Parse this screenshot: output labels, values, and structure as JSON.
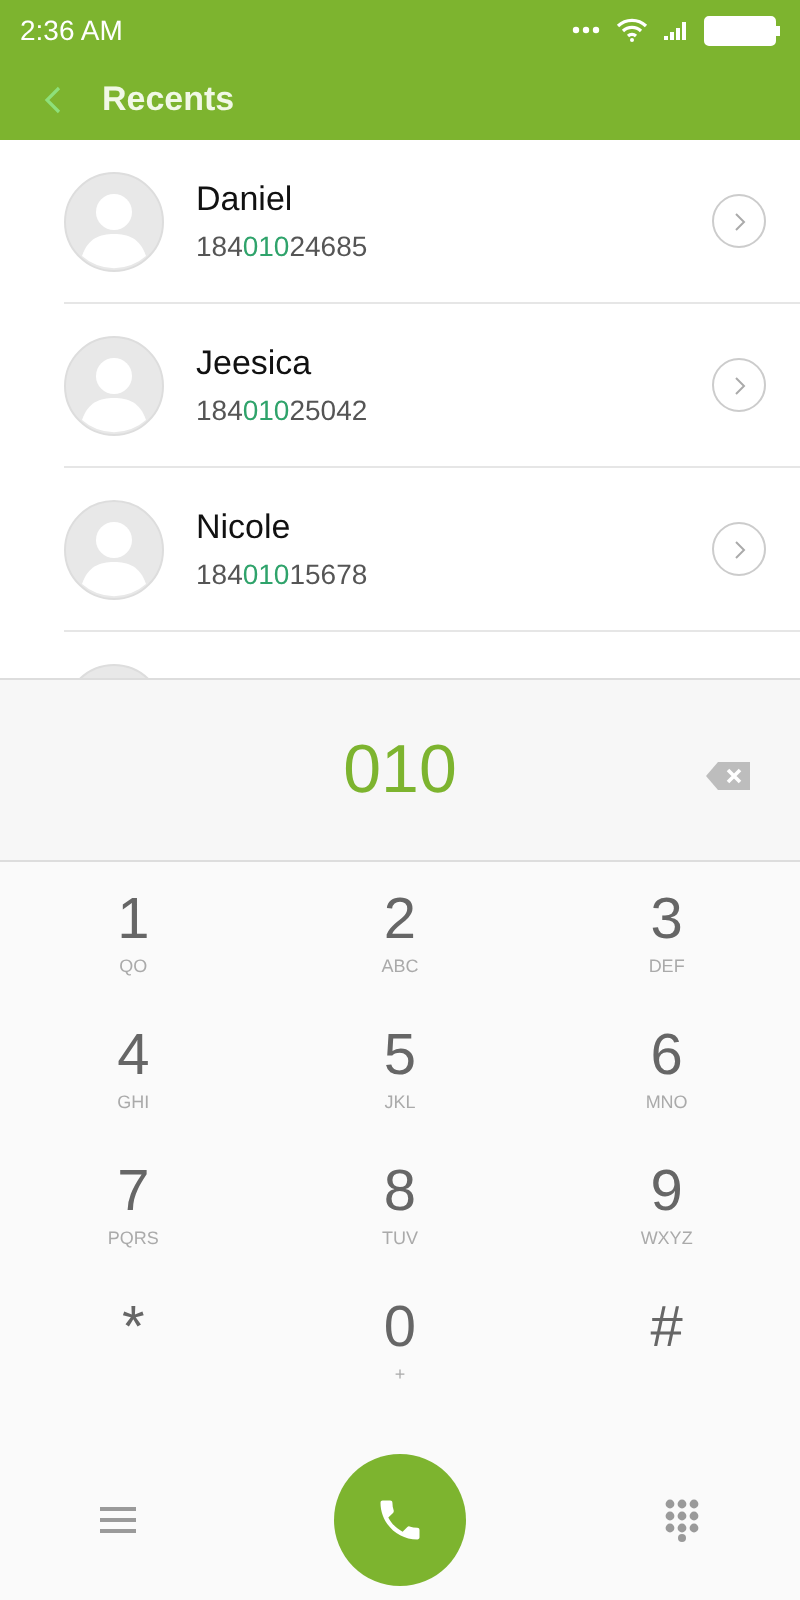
{
  "status_bar": {
    "time": "2:36 AM"
  },
  "header": {
    "title": "Recents"
  },
  "contacts": [
    {
      "name": "Daniel",
      "number_parts": [
        {
          "text": "184",
          "match": false
        },
        {
          "text": "010",
          "match": true
        },
        {
          "text": "24685",
          "match": false
        }
      ]
    },
    {
      "name": "Jeesica",
      "number_parts": [
        {
          "text": "184",
          "match": false
        },
        {
          "text": "010",
          "match": true
        },
        {
          "text": "25042",
          "match": false
        }
      ]
    },
    {
      "name": "Nicole",
      "number_parts": [
        {
          "text": "184",
          "match": false
        },
        {
          "text": "010",
          "match": true
        },
        {
          "text": "15678",
          "match": false
        }
      ]
    }
  ],
  "dialer": {
    "entered": "010",
    "keys": [
      {
        "digit": "1",
        "letters": "QO"
      },
      {
        "digit": "2",
        "letters": "ABC"
      },
      {
        "digit": "3",
        "letters": "DEF"
      },
      {
        "digit": "4",
        "letters": "GHI"
      },
      {
        "digit": "5",
        "letters": "JKL"
      },
      {
        "digit": "6",
        "letters": "MNO"
      },
      {
        "digit": "7",
        "letters": "PQRS"
      },
      {
        "digit": "8",
        "letters": "TUV"
      },
      {
        "digit": "9",
        "letters": "WXYZ"
      },
      {
        "digit": "*"
      },
      {
        "digit": "0",
        "letters": "+"
      },
      {
        "digit": "#"
      }
    ]
  }
}
